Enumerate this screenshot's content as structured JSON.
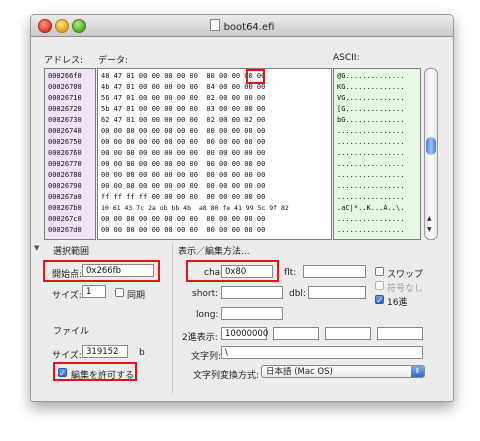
{
  "window": {
    "title": "boot64.efi"
  },
  "header": {
    "address_label": "アドレス:",
    "data_label": "データ:",
    "ascii_label": "ASCII:"
  },
  "addresses": [
    "000266f0",
    "00026700",
    "00026710",
    "00026720",
    "00026730",
    "00026740",
    "00026750",
    "00026760",
    "00026770",
    "00026780",
    "00026790",
    "000267a0",
    "000267b0",
    "000267c0",
    "000267d0"
  ],
  "hex_rows": [
    "48 47 01 00 00 00 00 00  80 00 00 00 00",
    "4b 47 01 00 00 00 00 00  04 00 00 00 00",
    "56 47 01 00 00 00 00 00  02 00 00 00 00",
    "5b 47 01 00 00 00 00 00  03 00 00 00 00",
    "62 47 01 00 00 00 00 00  02 00 00 02 00",
    "00 00 00 00 00 00 00 00  00 00 00 00 00",
    "00 00 00 00 00 00 00 00  00 00 00 00 00",
    "00 00 00 00 00 00 00 00  00 00 00 00 00",
    "00 00 00 00 00 00 00 00  00 00 00 00 00",
    "00 00 00 00 00 00 00 00  00 00 00 00 00",
    "00 00 00 00 00 00 00 00  00 00 00 00 00",
    "ff ff ff ff 00 00 00 00  00 00 00 00 00",
    "10 61 43 7c 2a ob bb 4b  a8 80 fe 41 99 5c 9f 82",
    "00 00 00 00 00 00 00 00  00 00 00 00 00",
    "00 00 00 00 00 00 00 00  00 00 00 00 00"
  ],
  "ascii_rows": [
    "@G..............",
    "KG..............",
    "VG..............",
    "[G..............",
    "bG..............",
    "................",
    "................",
    "................",
    "................",
    "................",
    "................",
    "................",
    ".aC|*..K...A..\\.",
    "................",
    "................"
  ],
  "selection": {
    "section_label": "選択範囲",
    "start_label": "開始点:",
    "start_value": "0x266fb",
    "size_label": "サイズ:",
    "size_value": "1",
    "sync_label": "同期"
  },
  "file": {
    "section_label": "ファイル",
    "size_label": "サイズ:",
    "size_value": "319152",
    "size_unit": "b",
    "allow_edit_label": "編集を許可する"
  },
  "display": {
    "section_label": "表示／編集方法...",
    "char_label": "char:",
    "char_value": "0x80",
    "flt_label": "flt:",
    "short_label": "short:",
    "dbl_label": "dbl:",
    "long_label": "long:",
    "binary_label": "2進表示:",
    "binary_value": "10000000",
    "string_label": "文字列:",
    "string_value": "\\",
    "conv_label": "文字列変換方式:",
    "conv_value": "日本語 (Mac OS)",
    "swap_label": "スワップ",
    "unsigned_label": "符号なし",
    "hex_label": "16進"
  },
  "colors": {
    "highlight": "#e01515",
    "address_bg": "#efe3f5",
    "ascii_bg": "#e6f7e3"
  }
}
